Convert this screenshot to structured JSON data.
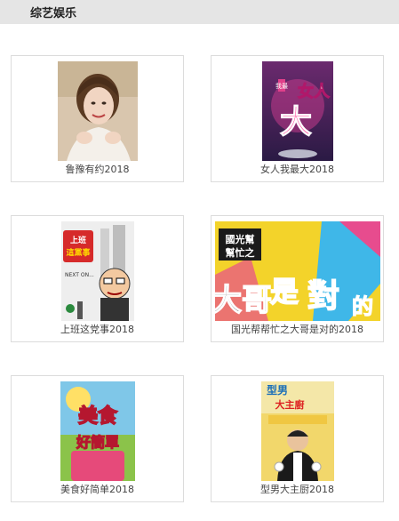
{
  "header": {
    "title": "综艺娱乐"
  },
  "cards": [
    {
      "title": "鲁豫有约2018",
      "thumbnail_icon": "portrait-woman-photo"
    },
    {
      "title": "女人我最大2018",
      "thumbnail_icon": "show-poster-nvren",
      "poster_text": [
        "我最",
        "女人",
        "大"
      ]
    },
    {
      "title": "上班这党事2018",
      "thumbnail_icon": "show-poster-shangban",
      "poster_text": [
        "上班",
        "這黨事",
        "NEXT ON..."
      ]
    },
    {
      "title": "国光帮帮忙之大哥是对的2018",
      "thumbnail_icon": "show-poster-guoguang",
      "poster_text": [
        "國光幫",
        "幫忙之",
        "大哥",
        "是",
        "對",
        "的"
      ]
    },
    {
      "title": "美食好简单2018",
      "thumbnail_icon": "show-poster-meishi",
      "poster_text": [
        "美食",
        "好簡單"
      ]
    },
    {
      "title": "型男大主厨2018",
      "thumbnail_icon": "show-poster-xingnan",
      "poster_text": [
        "型男",
        "大主廚"
      ]
    }
  ]
}
